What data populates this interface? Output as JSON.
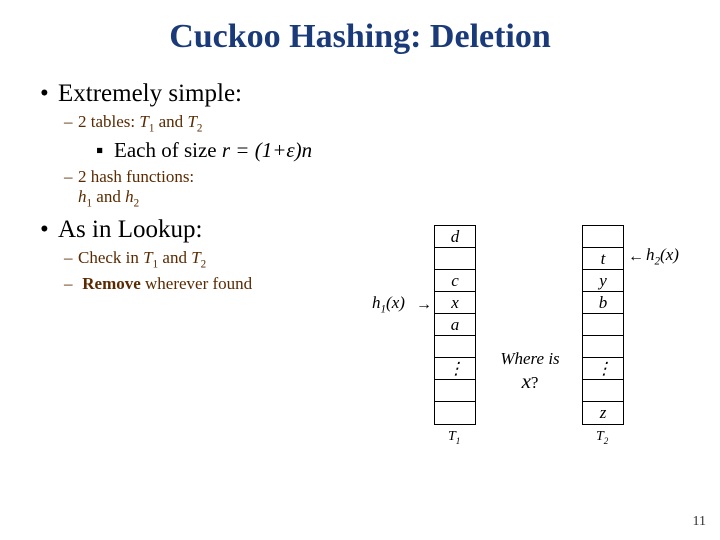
{
  "title": "Cuckoo Hashing: Deletion",
  "bullets": {
    "b1a": "Extremely simple:",
    "b2a_pre": "2 tables: ",
    "b2a_t1": "T",
    "b2a_s1": "1",
    "b2a_and": " and ",
    "b2a_t2": "T",
    "b2a_s2": "2",
    "b3a_pre": "Each of size ",
    "b3a_expr": "r = (1+ε)n",
    "b2b_l1": "2 hash functions:",
    "b2b_h1": "h",
    "b2b_s1": "1",
    "b2b_and": " and ",
    "b2b_h2": "h",
    "b2b_s2": "2",
    "b1b": "As in Lookup:",
    "b2c_pre": "Check in ",
    "b2c_t1": "T",
    "b2c_s1": "1",
    "b2c_and": " and ",
    "b2c_t2": "T",
    "b2c_s2": "2",
    "b2d_pre": "Remove",
    "b2d_rest": " wherever found"
  },
  "diagram": {
    "h1_label_pre": "h",
    "h1_label_sub": "1",
    "h1_label_post": "(x)",
    "h2_label_pre": "h",
    "h2_label_sub": "2",
    "h2_label_post": "(x)",
    "t1": {
      "name_pre": "T",
      "name_sub": "1",
      "cells": [
        "d",
        "",
        "c",
        "x",
        "a",
        "",
        "⋮",
        "",
        ""
      ]
    },
    "t2": {
      "name_pre": "T",
      "name_sub": "2",
      "cells": [
        "",
        "t",
        "y",
        "b",
        "",
        "",
        "⋮",
        "",
        "z"
      ]
    },
    "where_l1": "Where is",
    "where_l2_pre": "x",
    "where_l2_post": "?"
  },
  "page": "11"
}
